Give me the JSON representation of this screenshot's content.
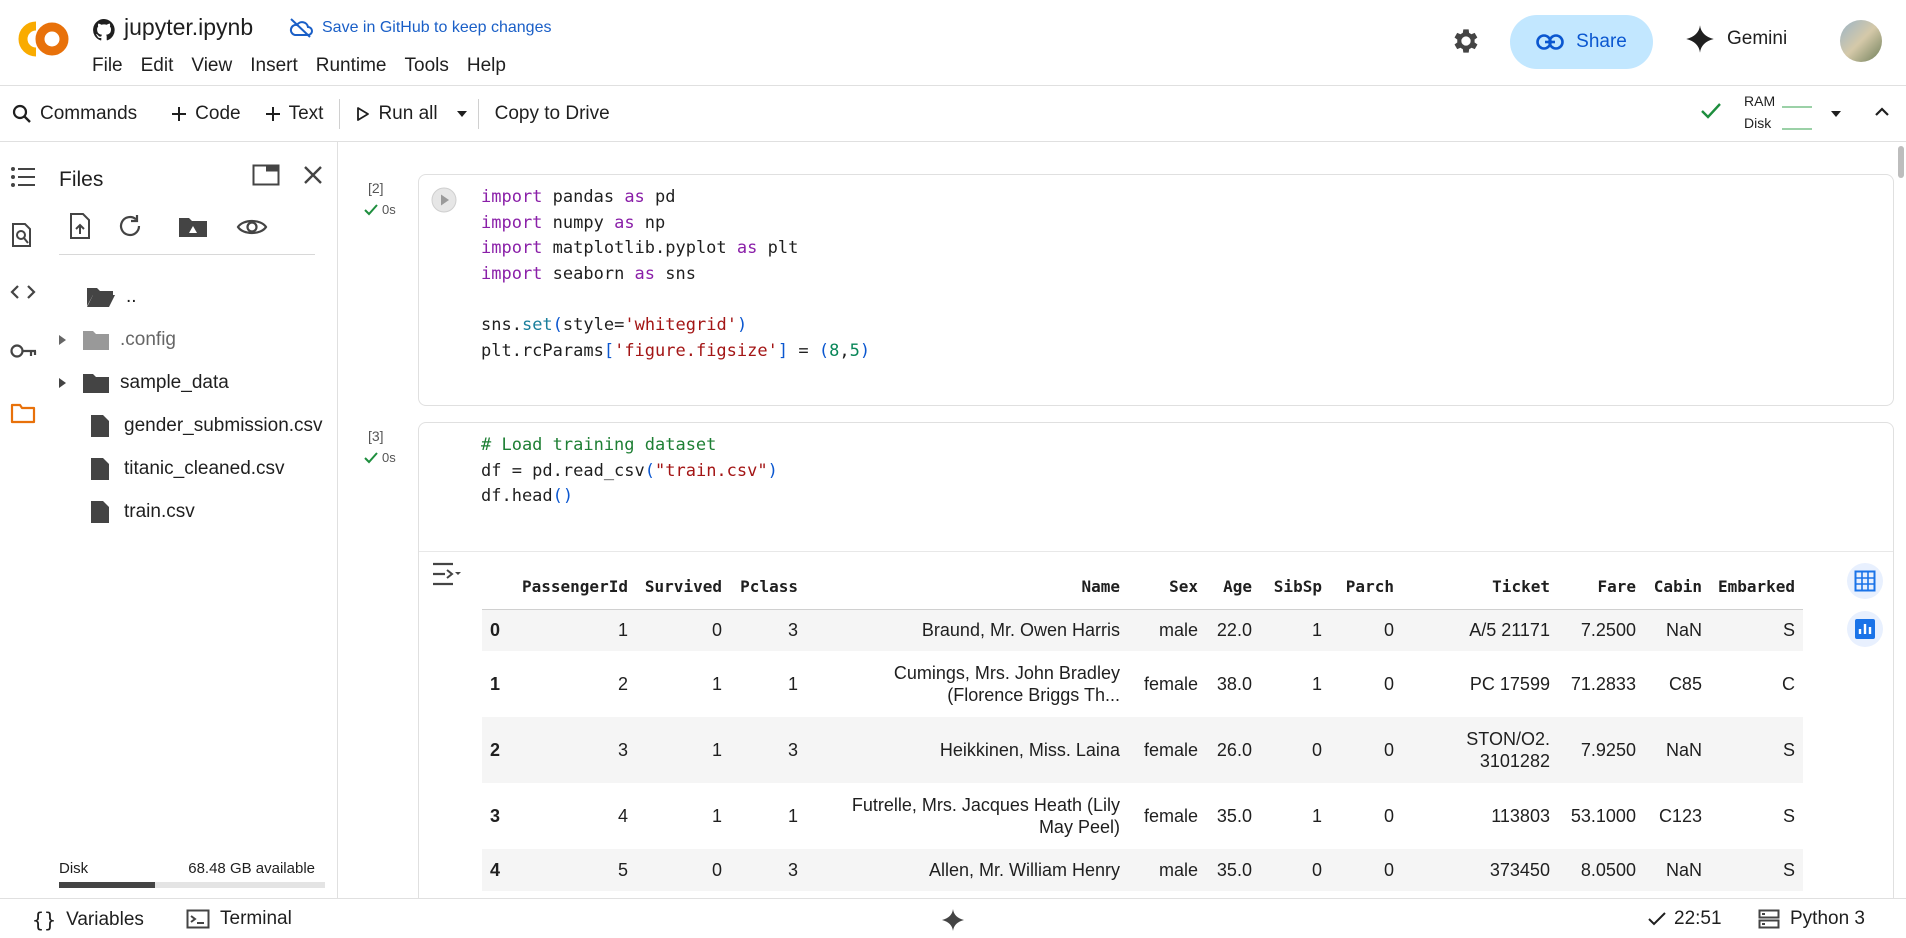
{
  "header": {
    "notebook_title": "jupyter.ipynb",
    "save_hint": "Save in GitHub to keep changes",
    "menu": [
      "File",
      "Edit",
      "View",
      "Insert",
      "Runtime",
      "Tools",
      "Help"
    ],
    "share_label": "Share",
    "gemini_label": "Gemini"
  },
  "toolbar": {
    "commands_label": "Commands",
    "code_label": "Code",
    "text_label": "Text",
    "run_all_label": "Run all",
    "copy_to_drive_label": "Copy to Drive",
    "ram_label": "RAM",
    "disk_label": "Disk"
  },
  "files_panel": {
    "title": "Files",
    "tree": [
      {
        "label": "..",
        "type": "folder-open"
      },
      {
        "label": ".config",
        "type": "folder",
        "expandable": true,
        "muted": true
      },
      {
        "label": "sample_data",
        "type": "folder",
        "expandable": true
      },
      {
        "label": "gender_submission.csv",
        "type": "file"
      },
      {
        "label": "titanic_cleaned.csv",
        "type": "file"
      },
      {
        "label": "train.csv",
        "type": "file"
      }
    ],
    "disk_label": "Disk",
    "disk_available": "68.48 GB available",
    "disk_used_fraction": 0.36
  },
  "cells": [
    {
      "exec_count": "[2]",
      "status": "0s",
      "code_lines": [
        "import pandas as pd",
        "import numpy as np",
        "import matplotlib.pyplot as plt",
        "import seaborn as sns",
        "",
        "sns.set(style='whitegrid')",
        "plt.rcParams['figure.figsize'] = (8,5)"
      ]
    },
    {
      "exec_count": "[3]",
      "status": "0s",
      "code_lines": [
        "# Load training dataset",
        "df = pd.read_csv(\"train.csv\")",
        "df.head()"
      ]
    }
  ],
  "output_table": {
    "columns": [
      "",
      "PassengerId",
      "Survived",
      "Pclass",
      "Name",
      "Sex",
      "Age",
      "SibSp",
      "Parch",
      "Ticket",
      "Fare",
      "Cabin",
      "Embarked"
    ],
    "rows": [
      [
        "0",
        "1",
        "0",
        "3",
        "Braund, Mr. Owen Harris",
        "male",
        "22.0",
        "1",
        "0",
        "A/5 21171",
        "7.2500",
        "NaN",
        "S"
      ],
      [
        "1",
        "2",
        "1",
        "1",
        "Cumings, Mrs. John Bradley (Florence Briggs Th...",
        "female",
        "38.0",
        "1",
        "0",
        "PC 17599",
        "71.2833",
        "C85",
        "C"
      ],
      [
        "2",
        "3",
        "1",
        "3",
        "Heikkinen, Miss. Laina",
        "female",
        "26.0",
        "0",
        "0",
        "STON/O2. 3101282",
        "7.9250",
        "NaN",
        "S"
      ],
      [
        "3",
        "4",
        "1",
        "1",
        "Futrelle, Mrs. Jacques Heath (Lily May Peel)",
        "female",
        "35.0",
        "1",
        "0",
        "113803",
        "53.1000",
        "C123",
        "S"
      ],
      [
        "4",
        "5",
        "0",
        "3",
        "Allen, Mr. William Henry",
        "male",
        "35.0",
        "0",
        "0",
        "373450",
        "8.0500",
        "NaN",
        "S"
      ]
    ]
  },
  "statusbar": {
    "variables_label": "Variables",
    "terminal_label": "Terminal",
    "time": "22:51",
    "kernel": "Python 3"
  },
  "colors": {
    "accent_blue": "#0b57d0",
    "share_bg": "#c2e7ff",
    "logo_orange": "#f9ab00",
    "ok_green": "#1e8e3e",
    "files_rail_active": "#e8710a"
  }
}
